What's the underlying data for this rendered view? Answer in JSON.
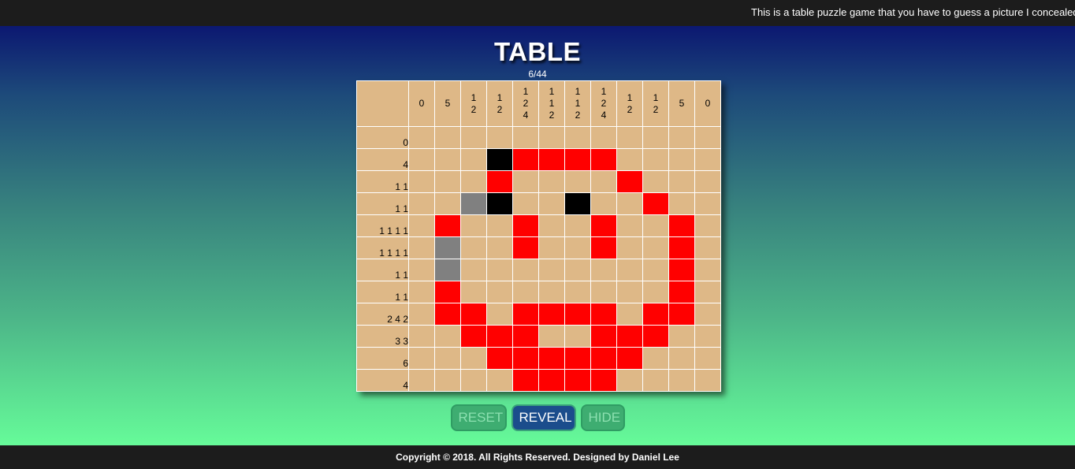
{
  "marquee": "This is a table puzzle game that you have to guess a picture I concealed",
  "title": "TABLE",
  "counter": "6/44",
  "board": {
    "column_clues": [
      [
        "0"
      ],
      [
        "5"
      ],
      [
        "1",
        "2"
      ],
      [
        "1",
        "2"
      ],
      [
        "1",
        "2",
        "4"
      ],
      [
        "1",
        "1",
        "2"
      ],
      [
        "1",
        "1",
        "2"
      ],
      [
        "1",
        "2",
        "4"
      ],
      [
        "1",
        "2"
      ],
      [
        "1",
        "2"
      ],
      [
        "5"
      ],
      [
        "0"
      ]
    ],
    "row_clues": [
      "0",
      "4",
      "1 1",
      "1 1",
      "1 1 1 1",
      "1 1 1 1",
      "1 1",
      "1 1",
      "2 4 2",
      "3 3",
      "6",
      "4"
    ],
    "cell_states_legend": {
      "0": "empty",
      "1": "filled-red",
      "2": "marked-black",
      "3": "marked-gray"
    },
    "cells": [
      [
        0,
        0,
        0,
        0,
        0,
        0,
        0,
        0,
        0,
        0,
        0,
        0
      ],
      [
        0,
        0,
        0,
        2,
        1,
        1,
        1,
        1,
        0,
        0,
        0,
        0
      ],
      [
        0,
        0,
        0,
        1,
        0,
        0,
        0,
        0,
        1,
        0,
        0,
        0
      ],
      [
        0,
        0,
        3,
        2,
        0,
        0,
        2,
        0,
        0,
        1,
        0,
        0
      ],
      [
        0,
        1,
        0,
        0,
        1,
        0,
        0,
        1,
        0,
        0,
        1,
        0
      ],
      [
        0,
        3,
        0,
        0,
        1,
        0,
        0,
        1,
        0,
        0,
        1,
        0
      ],
      [
        0,
        3,
        0,
        0,
        0,
        0,
        0,
        0,
        0,
        0,
        1,
        0
      ],
      [
        0,
        1,
        0,
        0,
        0,
        0,
        0,
        0,
        0,
        0,
        1,
        0
      ],
      [
        0,
        1,
        1,
        0,
        1,
        1,
        1,
        1,
        0,
        1,
        1,
        0
      ],
      [
        0,
        0,
        1,
        1,
        1,
        0,
        0,
        1,
        1,
        1,
        0,
        0
      ],
      [
        0,
        0,
        0,
        1,
        1,
        1,
        1,
        1,
        1,
        0,
        0,
        0
      ],
      [
        0,
        0,
        0,
        0,
        1,
        1,
        1,
        1,
        0,
        0,
        0,
        0
      ]
    ],
    "colors": {
      "background": "#deb887",
      "filled": "#ff0000",
      "black": "#000000",
      "gray": "#808080",
      "grid_line": "#ffffff"
    }
  },
  "buttons": {
    "reset_label": "RESET",
    "reveal_label": "REVEAL",
    "hide_label": "HIDE"
  },
  "footer": {
    "copyright": "Copyright © 2018. All Rights Reserved. Designed by Daniel Lee"
  }
}
